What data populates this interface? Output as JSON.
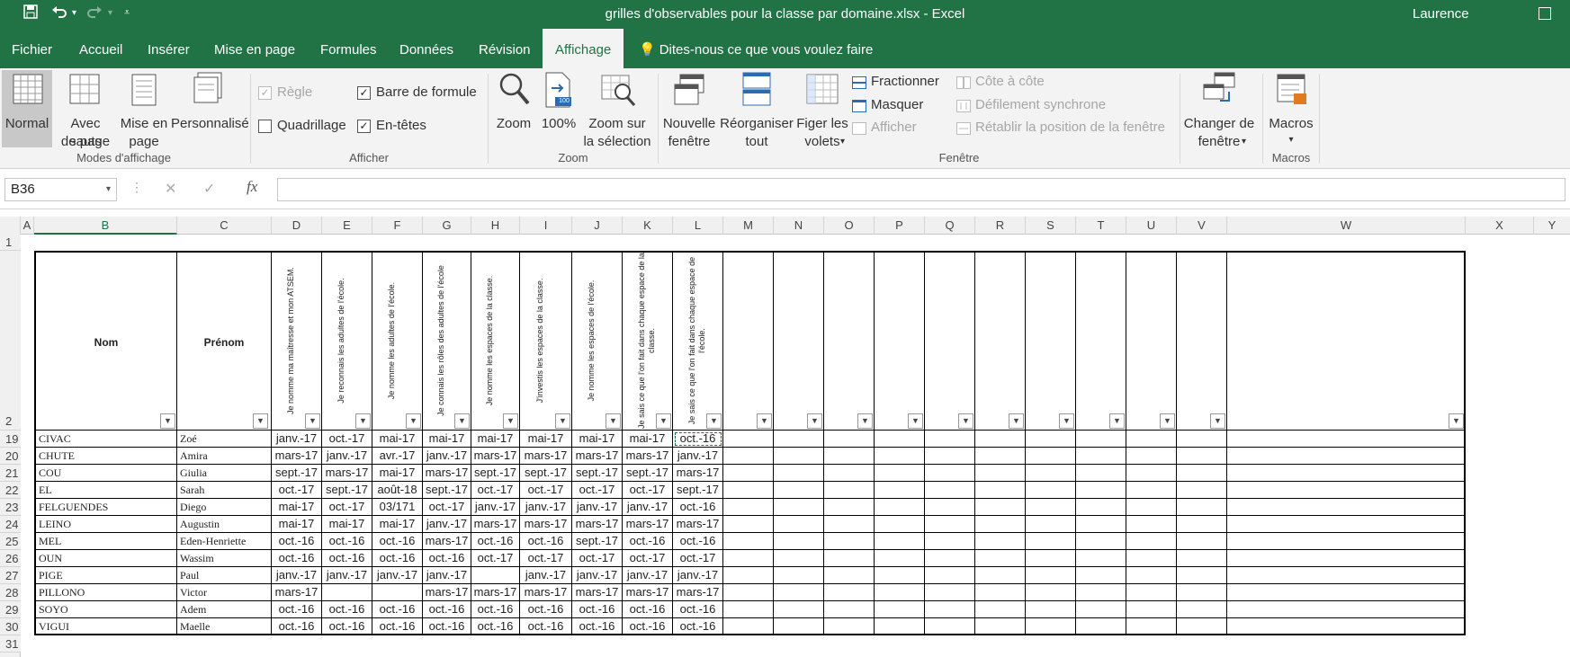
{
  "app": {
    "title": "grilles d'observables pour la classe par domaine.xlsx  -  Excel",
    "user": "Laurence"
  },
  "quick_access": {
    "save_icon": "save-icon",
    "undo_icon": "undo-icon",
    "redo_icon": "redo-icon",
    "customize_icon": "customize-icon"
  },
  "tabs": [
    "Fichier",
    "Accueil",
    "Insérer",
    "Mise en page",
    "Formules",
    "Données",
    "Révision",
    "Affichage"
  ],
  "active_tab": "Affichage",
  "tell_me": "Dites-nous ce que vous voulez faire",
  "ribbon": {
    "modes": {
      "normal": "Normal",
      "page_break_1": "Avec sauts",
      "page_break_2": "de page",
      "layout_1": "Mise en",
      "layout_2": "page",
      "custom": "Personnalisé",
      "group": "Modes d'affichage"
    },
    "show": {
      "ruler": "Règle",
      "formula_bar": "Barre de formule",
      "gridlines": "Quadrillage",
      "headings": "En-têtes",
      "group": "Afficher",
      "ruler_checked": true,
      "formula_bar_checked": true,
      "gridlines_checked": false,
      "headings_checked": true
    },
    "zoom": {
      "zoom": "Zoom",
      "hundred": "100%",
      "hundred_badge": "100",
      "sel_1": "Zoom sur",
      "sel_2": "la sélection",
      "group": "Zoom"
    },
    "window": {
      "new_1": "Nouvelle",
      "new_2": "fenêtre",
      "arrange_1": "Réorganiser",
      "arrange_2": "tout",
      "freeze_1": "Figer les",
      "freeze_2": "volets",
      "split": "Fractionner",
      "hide": "Masquer",
      "unhide": "Afficher",
      "side": "Côte à côte",
      "sync": "Défilement synchrone",
      "reset": "Rétablir la position de la fenêtre",
      "switch_1": "Changer de",
      "switch_2": "fenêtre",
      "group": "Fenêtre"
    },
    "macros": {
      "label": "Macros",
      "group": "Macros"
    }
  },
  "formula_bar": {
    "name_box": "B36",
    "cancel": "✕",
    "enter": "✓",
    "fx": "fx",
    "value": ""
  },
  "columns": [
    "A",
    "B",
    "C",
    "D",
    "E",
    "F",
    "G",
    "H",
    "I",
    "J",
    "K",
    "L",
    "M",
    "N",
    "O",
    "P",
    "Q",
    "R",
    "S",
    "T",
    "U",
    "V",
    "W",
    "X",
    "Y"
  ],
  "row_numbers": [
    "1",
    "2",
    "19",
    "20",
    "21",
    "22",
    "23",
    "24",
    "25",
    "26",
    "27",
    "28",
    "29",
    "30",
    "31"
  ],
  "table": {
    "headers": {
      "nom": "Nom",
      "prenom": "Prénom",
      "rotated": [
        "Je nomme ma maîtresse et mon ATSEM.",
        "Je reconnais les adultes de l'école.",
        "Je nomme les adultes de l'école.",
        "Je connais les rôles des adultes de l'école",
        "Je nomme les espaces de la classe.",
        "J'investis les espaces de la classe.",
        "Je nomme les espaces de l'école.",
        "Je sais ce que l'on fait dans chaque espace de la classe.",
        "Je sais ce que l'on fait dans chaque espace de l'école."
      ]
    },
    "rows": [
      {
        "nom": "CIVAC",
        "prenom": "Zoé",
        "vals": [
          "janv.-17",
          "oct.-17",
          "mai-17",
          "mai-17",
          "mai-17",
          "mai-17",
          "mai-17",
          "mai-17",
          "oct.-16"
        ]
      },
      {
        "nom": "CHUTE",
        "prenom": "Amira",
        "vals": [
          "mars-17",
          "janv.-17",
          "avr.-17",
          "janv.-17",
          "mars-17",
          "mars-17",
          "mars-17",
          "mars-17",
          "janv.-17"
        ]
      },
      {
        "nom": "COU",
        "prenom": "Giulia",
        "vals": [
          "sept.-17",
          "mars-17",
          "mai-17",
          "mars-17",
          "sept.-17",
          "sept.-17",
          "sept.-17",
          "sept.-17",
          "mars-17"
        ]
      },
      {
        "nom": "EL",
        "prenom": "Sarah",
        "vals": [
          "oct.-17",
          "sept.-17",
          "août-18",
          "sept.-17",
          "oct.-17",
          "oct.-17",
          "oct.-17",
          "oct.-17",
          "sept.-17"
        ]
      },
      {
        "nom": "FELGUENDES",
        "prenom": "Diego",
        "vals": [
          "mai-17",
          "oct.-17",
          "03/171",
          "oct.-17",
          "janv.-17",
          "janv.-17",
          "janv.-17",
          "janv.-17",
          "oct.-16"
        ]
      },
      {
        "nom": "LEINO",
        "prenom": "Augustin",
        "vals": [
          "mai-17",
          "mai-17",
          "mai-17",
          "janv.-17",
          "mars-17",
          "mars-17",
          "mars-17",
          "mars-17",
          "mars-17"
        ]
      },
      {
        "nom": "MEL",
        "prenom": "Eden-Henriette",
        "vals": [
          "oct.-16",
          "oct.-16",
          "oct.-16",
          "mars-17",
          "oct.-16",
          "oct.-16",
          "sept.-17",
          "oct.-16",
          "oct.-16"
        ]
      },
      {
        "nom": "OUN",
        "prenom": "Wassim",
        "vals": [
          "oct.-16",
          "oct.-16",
          "oct.-16",
          "oct.-16",
          "oct.-17",
          "oct.-17",
          "oct.-17",
          "oct.-17",
          "oct.-17"
        ]
      },
      {
        "nom": "PIGE",
        "prenom": "Paul",
        "vals": [
          "janv.-17",
          "janv.-17",
          "janv.-17",
          "janv.-17",
          "",
          "janv.-17",
          "janv.-17",
          "janv.-17",
          "janv.-17"
        ]
      },
      {
        "nom": "PILLONO",
        "prenom": "Victor",
        "vals": [
          "mars-17",
          "",
          "",
          "mars-17",
          "mars-17",
          "mars-17",
          "mars-17",
          "mars-17",
          "mars-17"
        ]
      },
      {
        "nom": "SOYO",
        "prenom": "Adem",
        "vals": [
          "oct.-16",
          "oct.-16",
          "oct.-16",
          "oct.-16",
          "oct.-16",
          "oct.-16",
          "oct.-16",
          "oct.-16",
          "oct.-16"
        ]
      },
      {
        "nom": "VIGUI",
        "prenom": "Maelle",
        "vals": [
          "oct.-16",
          "oct.-16",
          "oct.-16",
          "oct.-16",
          "oct.-16",
          "oct.-16",
          "oct.-16",
          "oct.-16",
          "oct.-16"
        ]
      }
    ]
  },
  "colors": {
    "excel_green": "#217346",
    "ribbon_bg": "#f3f3f3"
  }
}
